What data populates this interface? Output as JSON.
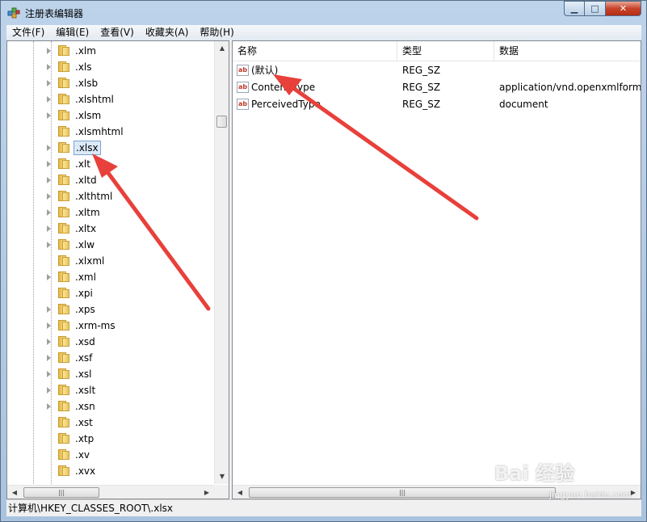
{
  "window": {
    "title": "注册表编辑器",
    "controls": {
      "minimize": "▁",
      "maximize": "□",
      "close": "✕"
    }
  },
  "menu": [
    "文件(F)",
    "编辑(E)",
    "查看(V)",
    "收藏夹(A)",
    "帮助(H)"
  ],
  "tree": {
    "items": [
      {
        "label": ".xlm",
        "expandable": true
      },
      {
        "label": ".xls",
        "expandable": true
      },
      {
        "label": ".xlsb",
        "expandable": true
      },
      {
        "label": ".xlshtml",
        "expandable": true
      },
      {
        "label": ".xlsm",
        "expandable": true
      },
      {
        "label": ".xlsmhtml",
        "expandable": false
      },
      {
        "label": ".xlsx",
        "expandable": true,
        "selected": true
      },
      {
        "label": ".xlt",
        "expandable": true
      },
      {
        "label": ".xltd",
        "expandable": true
      },
      {
        "label": ".xlthtml",
        "expandable": true
      },
      {
        "label": ".xltm",
        "expandable": true
      },
      {
        "label": ".xltx",
        "expandable": true
      },
      {
        "label": ".xlw",
        "expandable": true
      },
      {
        "label": ".xlxml",
        "expandable": false
      },
      {
        "label": ".xml",
        "expandable": true
      },
      {
        "label": ".xpi",
        "expandable": false
      },
      {
        "label": ".xps",
        "expandable": true
      },
      {
        "label": ".xrm-ms",
        "expandable": true
      },
      {
        "label": ".xsd",
        "expandable": true
      },
      {
        "label": ".xsf",
        "expandable": true
      },
      {
        "label": ".xsl",
        "expandable": true
      },
      {
        "label": ".xslt",
        "expandable": true
      },
      {
        "label": ".xsn",
        "expandable": true
      },
      {
        "label": ".xst",
        "expandable": false
      },
      {
        "label": ".xtp",
        "expandable": false
      },
      {
        "label": ".xv",
        "expandable": false
      },
      {
        "label": ".xvx",
        "expandable": false
      }
    ]
  },
  "values_list": {
    "columns": [
      "名称",
      "类型",
      "数据"
    ],
    "rows": [
      {
        "name": "(默认)",
        "type": "REG_SZ",
        "data": ""
      },
      {
        "name": "Content Type",
        "type": "REG_SZ",
        "data": "application/vnd.openxmlformats"
      },
      {
        "name": "PerceivedType",
        "type": "REG_SZ",
        "data": "document"
      }
    ]
  },
  "status_path": "计算机\\HKEY_CLASSES_ROOT\\.xlsx",
  "watermark": {
    "brand": "Bai 经验",
    "url": "jingyan.baidu.com"
  },
  "colors": {
    "arrow": "#e8403a",
    "selection": "#dbeaf9",
    "title_bar": "#bcd3ea"
  }
}
